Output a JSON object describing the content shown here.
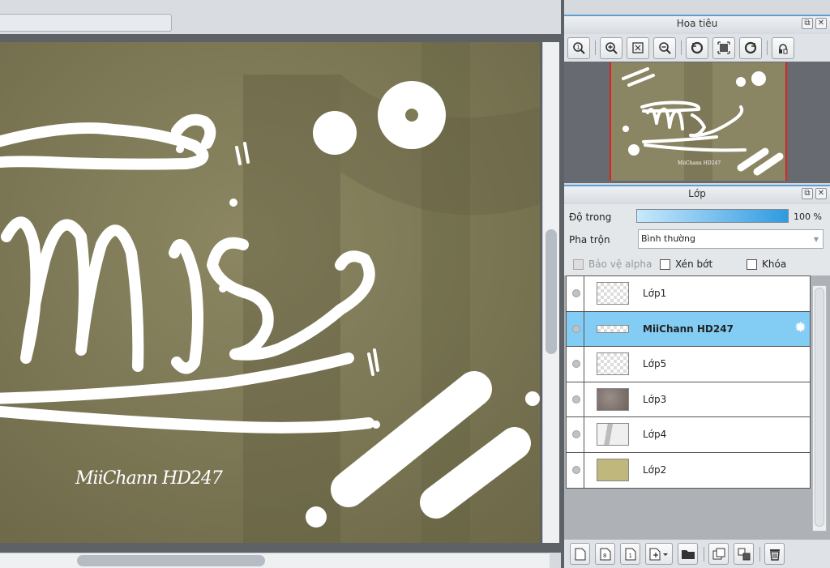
{
  "navigator": {
    "title": "Hoa tiêu",
    "toolbar": [
      "zoom-actual-icon",
      "zoom-in-icon",
      "fit-screen-icon",
      "zoom-out-icon",
      "rotate-left-icon",
      "fit-window-icon",
      "rotate-right-icon",
      "flip-icon"
    ]
  },
  "layers_panel": {
    "title": "Lớp",
    "opacity_label": "Độ trong",
    "opacity_value": "100 %",
    "opacity_fraction": 1.0,
    "blend_label": "Pha trộn",
    "blend_value": "Bình thường",
    "protect_alpha_label": "Bảo vệ alpha",
    "clip_label": "Xén bớt",
    "lock_label": "Khóa",
    "layers": [
      {
        "name": "Lớp1",
        "thumb": "transparent"
      },
      {
        "name": "MiiChann HD247",
        "thumb": "transparent",
        "selected": true
      },
      {
        "name": "Lớp5",
        "thumb": "transparent"
      },
      {
        "name": "Lớp3",
        "thumb": "texture"
      },
      {
        "name": "Lớp4",
        "thumb": "shadow"
      },
      {
        "name": "Lớp2",
        "thumb": "olive"
      }
    ],
    "toolbar": [
      "new-layer-icon",
      "new-raster-icon",
      "new-1bit-icon",
      "new-layer-menu-icon",
      "new-folder-icon",
      "duplicate-layer-icon",
      "merge-layer-icon",
      "delete-layer-icon"
    ]
  },
  "canvas": {
    "watermark_text": "MiiChann HD247",
    "background_color": "#7e7a55"
  },
  "colors": {
    "accent": "#5b9fd4",
    "selection": "#83cdf5",
    "opacity_fill": "#2e9be0"
  }
}
